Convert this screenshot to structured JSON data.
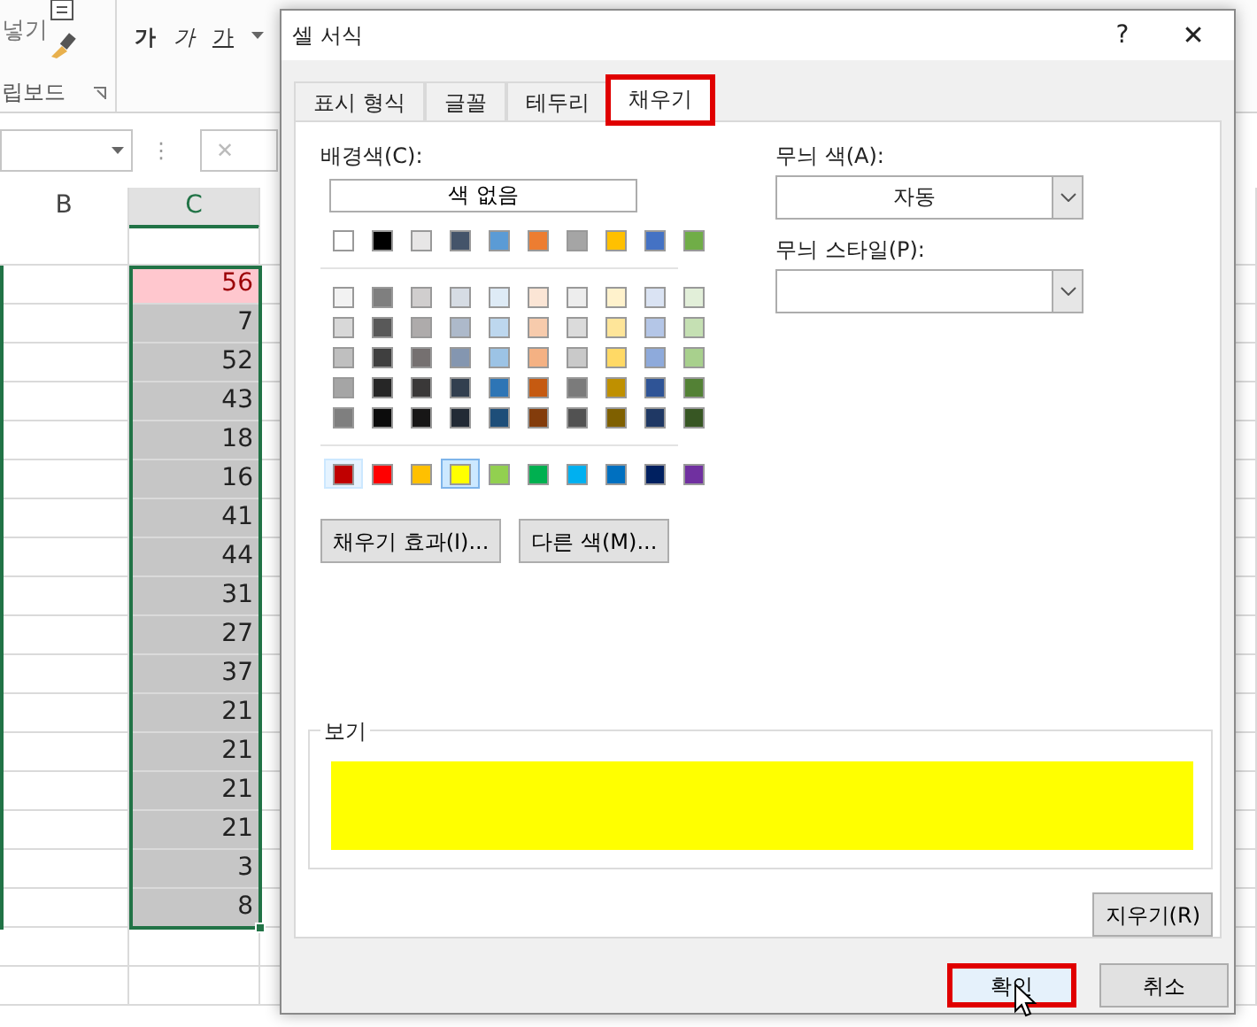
{
  "ribbon": {
    "paste_label": "넣기",
    "clipboard_group": "립보드",
    "font_buttons": [
      {
        "label": "가",
        "kind": "bold"
      },
      {
        "label": "가",
        "kind": "italic"
      },
      {
        "label": "가",
        "kind": "underline"
      }
    ]
  },
  "formula_bar": {
    "separator": "⋮",
    "cancel": "✕"
  },
  "sheet": {
    "columns": [
      {
        "label": "B",
        "selected": false
      },
      {
        "label": "C",
        "selected": true
      }
    ],
    "rows": [
      {
        "value": "56",
        "kind": "bad"
      },
      {
        "value": "7",
        "kind": "plain"
      },
      {
        "value": "52",
        "kind": "plain"
      },
      {
        "value": "43",
        "kind": "plain"
      },
      {
        "value": "18",
        "kind": "plain"
      },
      {
        "value": "16",
        "kind": "plain"
      },
      {
        "value": "41",
        "kind": "plain"
      },
      {
        "value": "44",
        "kind": "plain"
      },
      {
        "value": "31",
        "kind": "plain"
      },
      {
        "value": "27",
        "kind": "plain"
      },
      {
        "value": "37",
        "kind": "plain"
      },
      {
        "value": "21",
        "kind": "plain"
      },
      {
        "value": "21",
        "kind": "plain"
      },
      {
        "value": "21",
        "kind": "plain"
      },
      {
        "value": "21",
        "kind": "plain"
      },
      {
        "value": "3",
        "kind": "plain"
      },
      {
        "value": "8",
        "kind": "plain"
      }
    ]
  },
  "dialog": {
    "title": "셀 서식",
    "help": "?",
    "close": "✕",
    "tabs": [
      {
        "label": "표시 형식",
        "selected": false,
        "highlighted": false
      },
      {
        "label": "글꼴",
        "selected": false,
        "highlighted": false
      },
      {
        "label": "테두리",
        "selected": false,
        "highlighted": false
      },
      {
        "label": "채우기",
        "selected": true,
        "highlighted": true
      }
    ],
    "fill": {
      "background_label": "배경색(C):",
      "no_color": "색 없음",
      "theme_colors": [
        {
          "color": "#ffffff"
        },
        {
          "color": "#000000"
        },
        {
          "color": "#e7e6e6"
        },
        {
          "color": "#44546a"
        },
        {
          "color": "#5b9bd5"
        },
        {
          "color": "#ed7d31"
        },
        {
          "color": "#a5a5a5"
        },
        {
          "color": "#ffc000"
        },
        {
          "color": "#4472c4"
        },
        {
          "color": "#70ad47"
        }
      ],
      "shade_rows": [
        [
          {
            "color": "#f2f2f2"
          },
          {
            "color": "#7f7f7f"
          },
          {
            "color": "#d0cece"
          },
          {
            "color": "#d6dce4"
          },
          {
            "color": "#deebf6"
          },
          {
            "color": "#fbe5d5"
          },
          {
            "color": "#ededed"
          },
          {
            "color": "#fff2cc"
          },
          {
            "color": "#dae3f3"
          },
          {
            "color": "#e2efd9"
          }
        ],
        [
          {
            "color": "#d8d8d8"
          },
          {
            "color": "#595959"
          },
          {
            "color": "#aeabab"
          },
          {
            "color": "#adb9ca"
          },
          {
            "color": "#bdd7ee"
          },
          {
            "color": "#f7cbac"
          },
          {
            "color": "#dbdbdb"
          },
          {
            "color": "#fee599"
          },
          {
            "color": "#b4c6e7"
          },
          {
            "color": "#c5e0b3"
          }
        ],
        [
          {
            "color": "#bfbfbf"
          },
          {
            "color": "#3f3f3f"
          },
          {
            "color": "#757070"
          },
          {
            "color": "#8496b0"
          },
          {
            "color": "#9cc3e5"
          },
          {
            "color": "#f4b183"
          },
          {
            "color": "#c9c9c9"
          },
          {
            "color": "#ffd965"
          },
          {
            "color": "#8eaadb"
          },
          {
            "color": "#a8d08d"
          }
        ],
        [
          {
            "color": "#a5a5a5"
          },
          {
            "color": "#262626"
          },
          {
            "color": "#3a3838"
          },
          {
            "color": "#323f4f"
          },
          {
            "color": "#2e75b5"
          },
          {
            "color": "#c55a11"
          },
          {
            "color": "#7b7b7b"
          },
          {
            "color": "#bf9000"
          },
          {
            "color": "#2f5496"
          },
          {
            "color": "#538135"
          }
        ],
        [
          {
            "color": "#7f7f7f"
          },
          {
            "color": "#0c0c0c"
          },
          {
            "color": "#171616"
          },
          {
            "color": "#222a35"
          },
          {
            "color": "#1e4e79"
          },
          {
            "color": "#833c0b"
          },
          {
            "color": "#525252"
          },
          {
            "color": "#7f6000"
          },
          {
            "color": "#1f3864"
          },
          {
            "color": "#375623"
          }
        ]
      ],
      "standard_colors": [
        {
          "color": "#c00000",
          "selected": false,
          "hovered": true
        },
        {
          "color": "#ff0000",
          "selected": false,
          "hovered": false
        },
        {
          "color": "#ffc000",
          "selected": false,
          "hovered": false
        },
        {
          "color": "#ffff00",
          "selected": true,
          "hovered": false
        },
        {
          "color": "#92d050",
          "selected": false,
          "hovered": false
        },
        {
          "color": "#00b050",
          "selected": false,
          "hovered": false
        },
        {
          "color": "#00b0f0",
          "selected": false,
          "hovered": false
        },
        {
          "color": "#0070c0",
          "selected": false,
          "hovered": false
        },
        {
          "color": "#002060",
          "selected": false,
          "hovered": false
        },
        {
          "color": "#7030a0",
          "selected": false,
          "hovered": false
        }
      ],
      "fill_effects": "채우기 효과(I)...",
      "more_colors": "다른 색(M)...",
      "pattern_color_label": "무늬 색(A):",
      "pattern_color": "자동",
      "pattern_style_label": "무늬 스타일(P):",
      "sample_label": "보기",
      "sample": {
        "color": "#ffff00"
      },
      "clear": "지우기(R)"
    },
    "buttons": [
      {
        "label": "확인",
        "highlighted": true,
        "hovered": true
      },
      {
        "label": "취소",
        "highlighted": false,
        "hovered": false
      }
    ]
  }
}
